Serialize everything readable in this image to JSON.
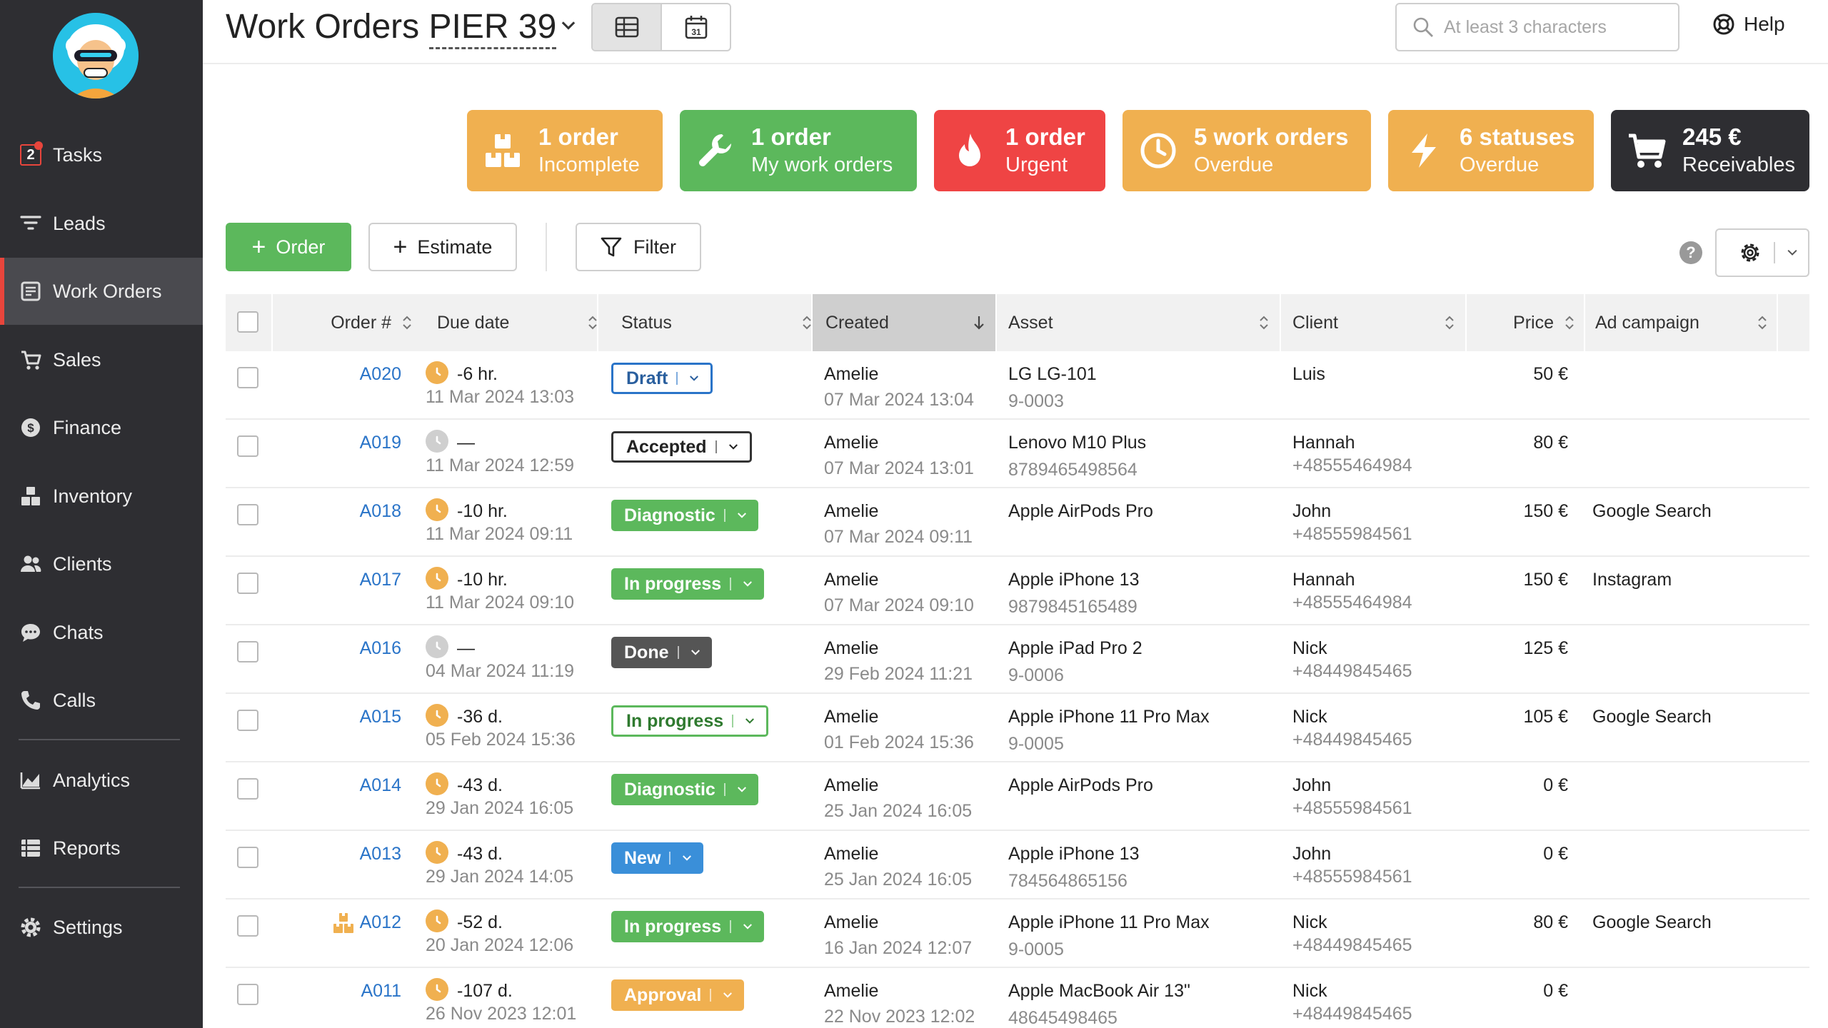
{
  "sidebar": {
    "task_count": "2",
    "items": [
      {
        "label": "Tasks",
        "icon": "tasks-icon"
      },
      {
        "label": "Leads",
        "icon": "filter-icon"
      },
      {
        "label": "Work Orders",
        "icon": "work-orders-icon",
        "active": true
      },
      {
        "label": "Sales",
        "icon": "cart-icon"
      },
      {
        "label": "Finance",
        "icon": "dollar-icon"
      },
      {
        "label": "Inventory",
        "icon": "boxes-icon"
      },
      {
        "label": "Clients",
        "icon": "users-icon"
      },
      {
        "label": "Chats",
        "icon": "chat-icon"
      },
      {
        "label": "Calls",
        "icon": "phone-icon"
      },
      {
        "label": "Analytics",
        "icon": "chart-icon"
      },
      {
        "label": "Reports",
        "icon": "list-icon"
      },
      {
        "label": "Settings",
        "icon": "gear-icon"
      }
    ]
  },
  "header": {
    "title": "Work Orders",
    "location": "PIER 39",
    "calendar_day": "31",
    "search_placeholder": "At least 3 characters",
    "help_label": "Help"
  },
  "cards": [
    {
      "count": "1 order",
      "label": "Incomplete",
      "color": "#f0b050",
      "icon": "boxes-icon"
    },
    {
      "count": "1 order",
      "label": "My work orders",
      "color": "#5cb85c",
      "icon": "wrench-icon"
    },
    {
      "count": "1 order",
      "label": "Urgent",
      "color": "#ef4444",
      "icon": "fire-icon"
    },
    {
      "count": "5 work orders",
      "label": "Overdue",
      "color": "#f0b050",
      "icon": "clock-icon"
    },
    {
      "count": "6 statuses",
      "label": "Overdue",
      "color": "#f0b050",
      "icon": "lightning-icon"
    },
    {
      "count": "245 €",
      "label": "Receivables",
      "color": "#2e2e32",
      "icon": "cart-icon"
    }
  ],
  "toolbar": {
    "order_label": "Order",
    "estimate_label": "Estimate",
    "filter_label": "Filter",
    "help_mark": "?"
  },
  "table": {
    "columns": [
      "Order #",
      "Due date",
      "Status",
      "Created",
      "Asset",
      "Client",
      "Price",
      "Ad campaign"
    ],
    "rows": [
      {
        "order": "A020",
        "due_rel": "-6 hr.",
        "due_date": "11 Mar 2024 13:03",
        "due_active": true,
        "status": "Draft",
        "status_style": "draft",
        "created_by": "Amelie",
        "created_at": "07 Mar 2024 13:04",
        "asset": "LG LG-101",
        "asset_id": "9-0003",
        "client": "Luis",
        "client_phone": "",
        "price": "50 €",
        "campaign": ""
      },
      {
        "order": "A019",
        "due_rel": "—",
        "due_date": "11 Mar 2024 12:59",
        "due_active": false,
        "status": "Accepted",
        "status_style": "accepted",
        "created_by": "Amelie",
        "created_at": "07 Mar 2024 13:01",
        "asset": "Lenovo M10 Plus",
        "asset_id": "8789465498564",
        "client": "Hannah",
        "client_phone": "+48555464984",
        "price": "80 €",
        "campaign": ""
      },
      {
        "order": "A018",
        "due_rel": "-10 hr.",
        "due_date": "11 Mar 2024 09:11",
        "due_active": true,
        "status": "Diagnostic",
        "status_style": "green",
        "created_by": "Amelie",
        "created_at": "07 Mar 2024 09:11",
        "asset": "Apple AirPods Pro",
        "asset_id": "",
        "client": "John",
        "client_phone": "+48555984561",
        "price": "150 €",
        "campaign": "Google Search"
      },
      {
        "order": "A017",
        "due_rel": "-10 hr.",
        "due_date": "11 Mar 2024 09:10",
        "due_active": true,
        "status": "In progress",
        "status_style": "green",
        "created_by": "Amelie",
        "created_at": "07 Mar 2024 09:10",
        "asset": "Apple iPhone 13",
        "asset_id": "9879845165489",
        "client": "Hannah",
        "client_phone": "+48555464984",
        "price": "150 €",
        "campaign": "Instagram"
      },
      {
        "order": "A016",
        "due_rel": "—",
        "due_date": "04 Mar 2024 11:19",
        "due_active": false,
        "status": "Done",
        "status_style": "done",
        "created_by": "Amelie",
        "created_at": "29 Feb 2024 11:21",
        "asset": "Apple iPad Pro 2",
        "asset_id": "9-0006",
        "client": "Nick",
        "client_phone": "+48449845465",
        "price": "125 €",
        "campaign": ""
      },
      {
        "order": "A015",
        "due_rel": "-36 d.",
        "due_date": "05 Feb 2024 15:36",
        "due_active": true,
        "status": "In progress",
        "status_style": "green-out",
        "created_by": "Amelie",
        "created_at": "01 Feb 2024 15:36",
        "asset": "Apple iPhone 11 Pro Max",
        "asset_id": "9-0005",
        "client": "Nick",
        "client_phone": "+48449845465",
        "price": "105 €",
        "campaign": "Google Search"
      },
      {
        "order": "A014",
        "due_rel": "-43 d.",
        "due_date": "29 Jan 2024 16:05",
        "due_active": true,
        "status": "Diagnostic",
        "status_style": "green",
        "created_by": "Amelie",
        "created_at": "25 Jan 2024 16:05",
        "asset": "Apple AirPods Pro",
        "asset_id": "",
        "client": "John",
        "client_phone": "+48555984561",
        "price": "0 €",
        "campaign": ""
      },
      {
        "order": "A013",
        "due_rel": "-43 d.",
        "due_date": "29 Jan 2024 14:05",
        "due_active": true,
        "status": "New",
        "status_style": "new",
        "created_by": "Amelie",
        "created_at": "25 Jan 2024 16:05",
        "asset": "Apple iPhone 13",
        "asset_id": "784564865156",
        "client": "John",
        "client_phone": "+48555984561",
        "price": "0 €",
        "campaign": ""
      },
      {
        "order": "A012",
        "due_rel": "-52 d.",
        "due_date": "20 Jan 2024 12:06",
        "due_active": true,
        "status": "In progress",
        "status_style": "green",
        "created_by": "Amelie",
        "created_at": "16 Jan 2024 12:07",
        "asset": "Apple iPhone 11 Pro Max",
        "asset_id": "9-0005",
        "client": "Nick",
        "client_phone": "+48449845465",
        "price": "80 €",
        "campaign": "Google Search",
        "incomplete_icon": true
      },
      {
        "order": "A011",
        "due_rel": "-107 d.",
        "due_date": "26 Nov 2023 12:01",
        "due_active": true,
        "status": "Approval",
        "status_style": "approval",
        "created_by": "Amelie",
        "created_at": "22 Nov 2023 12:02",
        "asset": "Apple MacBook Air 13\"",
        "asset_id": "48645498465",
        "client": "Nick",
        "client_phone": "+48449845465",
        "price": "0 €",
        "campaign": ""
      }
    ]
  }
}
